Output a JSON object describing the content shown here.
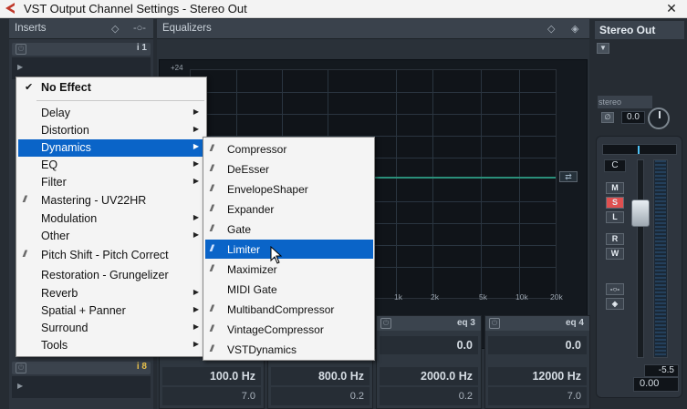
{
  "window": {
    "title": "VST Output Channel Settings - Stereo Out",
    "close": "✕"
  },
  "inserts": {
    "label": "Inserts",
    "slot1_num": "i 1",
    "slot8_num": "i 8"
  },
  "equalizers": {
    "label": "Equalizers",
    "db_top": "+24",
    "freq_ticks": [
      "1k",
      "2k",
      "5k",
      "10k",
      "20k"
    ],
    "bands": [
      {
        "gain": "",
        "freq": "100.0 Hz",
        "q": "7.0"
      },
      {
        "gain": "",
        "freq": "800.0 Hz",
        "q": "0.2"
      },
      {
        "label": "eq 3",
        "gain": "0.0",
        "freq": "2000.0 Hz",
        "q": "0.2"
      },
      {
        "label": "eq 4",
        "gain": "0.0",
        "freq": "12000 Hz",
        "q": "7.0"
      }
    ]
  },
  "output": {
    "title": "Stereo Out",
    "stereo_label": "stereo",
    "pan_value": "0.0",
    "pan_pos": "C",
    "buttons": [
      "M",
      "S",
      "L",
      "R",
      "W"
    ],
    "meter_peak": "-5.5",
    "fader_value": "0.00"
  },
  "menu": {
    "items": [
      {
        "label": "No Effect",
        "type": "check"
      },
      {
        "label": "Delay",
        "type": "sub"
      },
      {
        "label": "Distortion",
        "type": "sub"
      },
      {
        "label": "Dynamics",
        "type": "sub",
        "highlighted": true
      },
      {
        "label": "EQ",
        "type": "sub"
      },
      {
        "label": "Filter",
        "type": "sub"
      },
      {
        "label": "Mastering - UV22HR",
        "type": "plugin"
      },
      {
        "label": "Modulation",
        "type": "sub"
      },
      {
        "label": "Other",
        "type": "sub"
      },
      {
        "label": "Pitch Shift - Pitch Correct",
        "type": "plugin"
      },
      {
        "label": "Restoration - Grungelizer",
        "type": "plugin"
      },
      {
        "label": "Reverb",
        "type": "sub"
      },
      {
        "label": "Spatial + Panner",
        "type": "sub"
      },
      {
        "label": "Surround",
        "type": "sub"
      },
      {
        "label": "Tools",
        "type": "sub"
      }
    ]
  },
  "submenu": {
    "items": [
      {
        "label": "Compressor"
      },
      {
        "label": "DeEsser"
      },
      {
        "label": "EnvelopeShaper"
      },
      {
        "label": "Expander"
      },
      {
        "label": "Gate"
      },
      {
        "label": "Limiter",
        "highlighted": true
      },
      {
        "label": "Maximizer"
      },
      {
        "label": "MIDI Gate"
      },
      {
        "label": "MultibandCompressor"
      },
      {
        "label": "VintageCompressor"
      },
      {
        "label": "VSTDynamics"
      }
    ]
  },
  "colors": {
    "highlight": "#0a64c8",
    "eq_curve": "#2a8f7a",
    "solo": "#e05050"
  }
}
